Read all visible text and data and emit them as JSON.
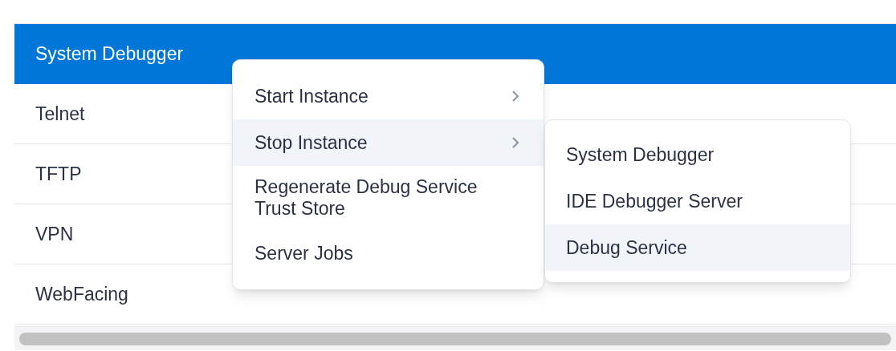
{
  "table": {
    "rows": [
      {
        "label": "System Debugger",
        "selected": true
      },
      {
        "label": "Telnet",
        "selected": false
      },
      {
        "label": "TFTP",
        "selected": false
      },
      {
        "label": "VPN",
        "selected": false
      },
      {
        "label": "WebFacing",
        "selected": false
      }
    ]
  },
  "context_menu": {
    "items": [
      {
        "label": "Start Instance",
        "has_submenu": true,
        "highlighted": false
      },
      {
        "label": "Stop Instance",
        "has_submenu": true,
        "highlighted": true
      },
      {
        "label": "Regenerate Debug Service Trust Store",
        "has_submenu": false,
        "highlighted": false
      },
      {
        "label": "Server Jobs",
        "has_submenu": false,
        "highlighted": false
      }
    ]
  },
  "submenu": {
    "items": [
      {
        "label": "System Debugger",
        "highlighted": false
      },
      {
        "label": "IDE Debugger Server",
        "highlighted": false
      },
      {
        "label": "Debug Service",
        "highlighted": true
      }
    ]
  }
}
